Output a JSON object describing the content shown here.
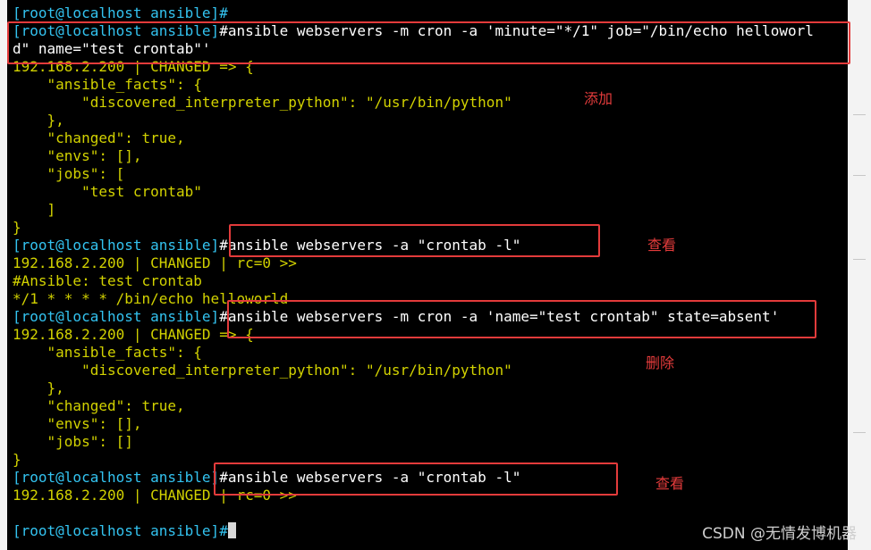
{
  "terminal": {
    "lines": [
      {
        "segs": [
          {
            "t": "[root@localhost ansible]#",
            "c": "prompt"
          }
        ]
      },
      {
        "segs": [
          {
            "t": "[root@localhost ansible]",
            "c": "prompt"
          },
          {
            "t": "#ansible webservers -m cron -a 'minute=\"*/1\" job=\"/bin/echo helloworl",
            "c": "cmd"
          }
        ]
      },
      {
        "segs": [
          {
            "t": "d\" name=\"test crontab\"'",
            "c": "cmd"
          }
        ]
      },
      {
        "segs": [
          {
            "t": "192.168.2.200 | CHANGED => {",
            "c": "out"
          }
        ]
      },
      {
        "segs": [
          {
            "t": "    \"ansible_facts\": {",
            "c": "out"
          }
        ]
      },
      {
        "segs": [
          {
            "t": "        \"discovered_interpreter_python\": \"/usr/bin/python\"",
            "c": "out"
          }
        ]
      },
      {
        "segs": [
          {
            "t": "    },",
            "c": "out"
          }
        ]
      },
      {
        "segs": [
          {
            "t": "    \"changed\": true,",
            "c": "out"
          }
        ]
      },
      {
        "segs": [
          {
            "t": "    \"envs\": [],",
            "c": "out"
          }
        ]
      },
      {
        "segs": [
          {
            "t": "    \"jobs\": [",
            "c": "out"
          }
        ]
      },
      {
        "segs": [
          {
            "t": "        \"test crontab\"",
            "c": "out"
          }
        ]
      },
      {
        "segs": [
          {
            "t": "    ]",
            "c": "out"
          }
        ]
      },
      {
        "segs": [
          {
            "t": "}",
            "c": "out"
          }
        ]
      },
      {
        "segs": [
          {
            "t": "[root@localhost ansible]",
            "c": "prompt"
          },
          {
            "t": "#ansible webservers -a \"crontab -l\"",
            "c": "cmd"
          }
        ]
      },
      {
        "segs": [
          {
            "t": "192.168.2.200 | CHANGED | rc=0 >>",
            "c": "out"
          }
        ]
      },
      {
        "segs": [
          {
            "t": "#Ansible: test crontab",
            "c": "out"
          }
        ]
      },
      {
        "segs": [
          {
            "t": "*/1 * * * * /bin/echo helloworld",
            "c": "out"
          }
        ]
      },
      {
        "segs": [
          {
            "t": "[root@localhost ansible]",
            "c": "prompt"
          },
          {
            "t": "#ansible webservers -m cron -a 'name=\"test crontab\" state=absent'",
            "c": "cmd"
          }
        ]
      },
      {
        "segs": [
          {
            "t": "192.168.2.200 | CHANGED => {",
            "c": "out"
          }
        ]
      },
      {
        "segs": [
          {
            "t": "    \"ansible_facts\": {",
            "c": "out"
          }
        ]
      },
      {
        "segs": [
          {
            "t": "        \"discovered_interpreter_python\": \"/usr/bin/python\"",
            "c": "out"
          }
        ]
      },
      {
        "segs": [
          {
            "t": "    },",
            "c": "out"
          }
        ]
      },
      {
        "segs": [
          {
            "t": "    \"changed\": true,",
            "c": "out"
          }
        ]
      },
      {
        "segs": [
          {
            "t": "    \"envs\": [],",
            "c": "out"
          }
        ]
      },
      {
        "segs": [
          {
            "t": "    \"jobs\": []",
            "c": "out"
          }
        ]
      },
      {
        "segs": [
          {
            "t": "}",
            "c": "out"
          }
        ]
      },
      {
        "segs": [
          {
            "t": "[root@localhost ansible]",
            "c": "prompt"
          },
          {
            "t": "#ansible webservers -a \"crontab -l\"",
            "c": "cmd"
          }
        ]
      },
      {
        "segs": [
          {
            "t": "192.168.2.200 | CHANGED | rc=0 >>",
            "c": "out"
          }
        ]
      },
      {
        "segs": [
          {
            "t": "",
            "c": "out"
          }
        ]
      },
      {
        "segs": [
          {
            "t": "[root@localhost ansible]#",
            "c": "prompt"
          }
        ],
        "cursor": true
      }
    ]
  },
  "annotations": {
    "add": "添加",
    "view1": "查看",
    "delete": "删除",
    "view2": "查看"
  },
  "colors": {
    "prompt": "#33c3f0",
    "command": "#ffffff",
    "output": "#d2d200",
    "annotation": "#e33b3b",
    "background": "#000000"
  },
  "watermark": "CSDN @无情发博机器"
}
